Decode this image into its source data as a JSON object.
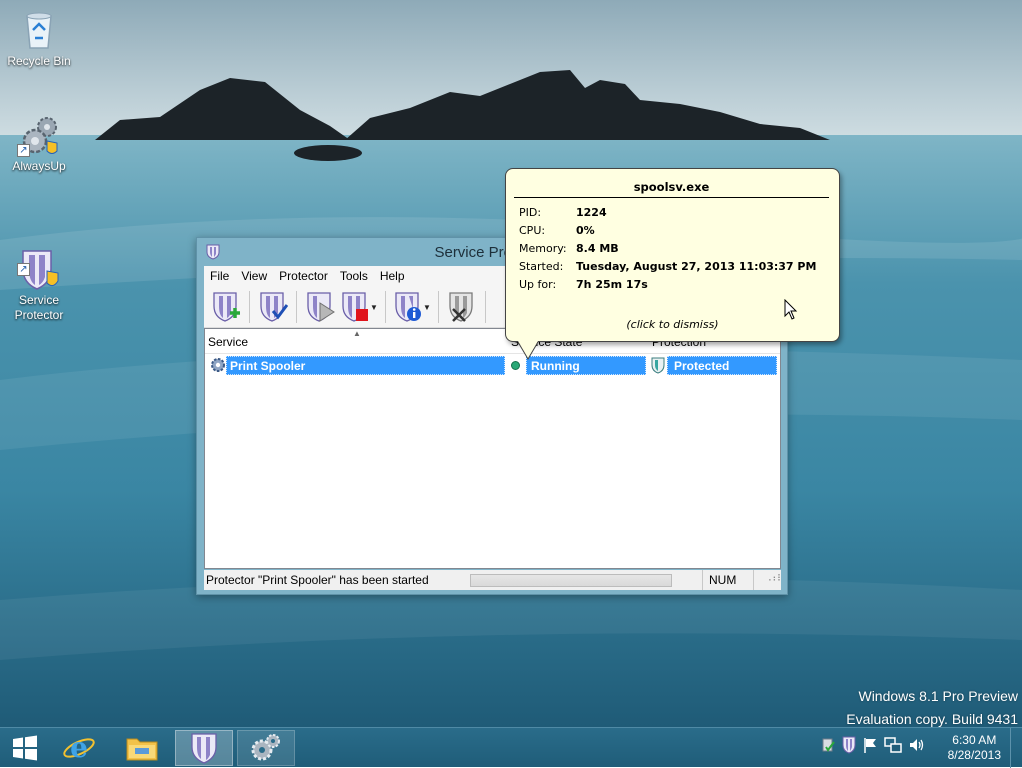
{
  "desktop": {
    "icons": [
      {
        "label": "Recycle Bin"
      },
      {
        "label": "AlwaysUp"
      },
      {
        "label": "Service\nProtector"
      }
    ],
    "watermark": {
      "line1": "Windows 8.1 Pro Preview",
      "line2": "Evaluation copy. Build 9431"
    }
  },
  "window": {
    "title": "Service Protector",
    "menu": [
      "File",
      "View",
      "Protector",
      "Tools",
      "Help"
    ],
    "toolbar": {
      "icons": [
        "add-protector-icon",
        "check-protector-icon",
        "start-protector-icon",
        "stop-protector-icon",
        "info-protector-icon",
        "delete-protector-icon"
      ]
    },
    "columns": {
      "service": "Service",
      "state": "Service State",
      "protection": "Protection"
    },
    "rows": [
      {
        "service": "Print Spooler",
        "state": "Running",
        "protection": "Protected"
      }
    ],
    "status": {
      "text": "Protector \"Print Spooler\" has been started",
      "num": "NUM"
    }
  },
  "balloon": {
    "title": "spoolsv.exe",
    "fields": [
      {
        "key": "PID:",
        "value": "1224"
      },
      {
        "key": "CPU:",
        "value": "0%"
      },
      {
        "key": "Memory:",
        "value": "8.4 MB"
      },
      {
        "key": "Started:",
        "value": "Tuesday, August 27, 2013 11:03:37 PM"
      },
      {
        "key": "Up for:",
        "value": "7h 25m 17s"
      }
    ],
    "dismiss": "(click to dismiss)"
  },
  "taskbar": {
    "time": "6:30 AM",
    "date": "8/28/2013"
  },
  "colors": {
    "selection": "#3399ff",
    "balloon_bg": "#ffffe1",
    "running_dot": "#2aa876",
    "taskbar": "#236481"
  }
}
